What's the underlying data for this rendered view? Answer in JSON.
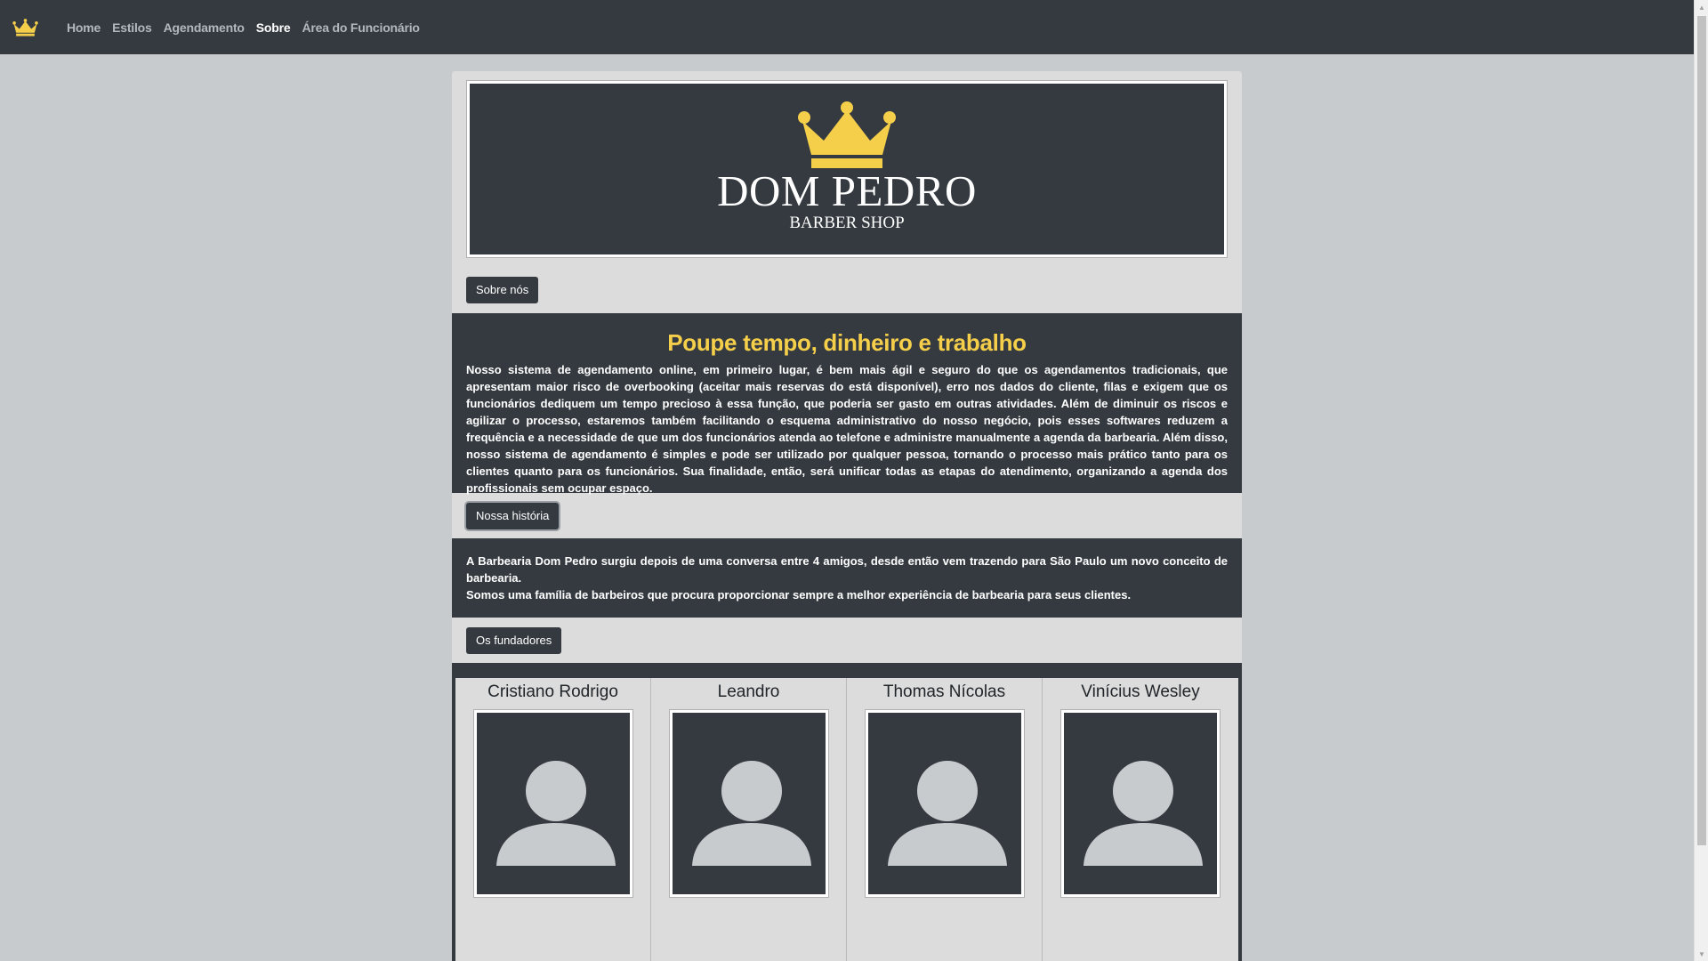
{
  "navbar": {
    "brand_icon": "crown-icon",
    "links": [
      {
        "label": "Home",
        "active": false
      },
      {
        "label": "Estilos",
        "active": false
      },
      {
        "label": "Agendamento",
        "active": false
      },
      {
        "label": "Sobre",
        "active": true
      },
      {
        "label": "Área do Funcionário",
        "active": false
      }
    ]
  },
  "hero": {
    "title": "DOM PEDRO",
    "subtitle": "BARBER SHOP",
    "crown_color": "#f6cf4a"
  },
  "sections": {
    "about_button": "Sobre nós",
    "about_heading": "Poupe tempo, dinheiro e trabalho",
    "about_text": "Nosso sistema de agendamento online, em primeiro lugar, é bem mais ágil e seguro do que os agendamentos tradicionais, que apresentam maior risco de overbooking (aceitar mais reservas do está disponível), erro nos dados do cliente, filas e exigem que os funcionários dediquem um tempo precioso à essa função, que poderia ser gasto em outras atividades. Além de diminuir os riscos e agilizar o processo, estaremos também facilitando o esquema administrativo do nosso negócio, pois esses softwares reduzem a frequência e a necessidade de que um dos funcionários atenda ao telefone e administre manualmente a agenda da barbearia. Além disso, nosso sistema de agendamento é simples e pode ser utilizado por qualquer pessoa, tornando o processo mais prático tanto para os clientes quanto para os funcionários. Sua finalidade, então, será unificar todas as etapas do atendimento, organizando a agenda dos profissionais sem ocupar espaço.",
    "history_button": "Nossa história",
    "history_p1": "A Barbearia Dom Pedro surgiu depois de uma conversa entre 4 amigos, desde então vem trazendo para São Paulo um novo conceito de barbearia.",
    "history_p2": "Somos uma família de barbeiros que procura proporcionar sempre a melhor experiência de barbearia para seus clientes.",
    "founders_button": "Os fundadores"
  },
  "founders": [
    {
      "name": "Cristiano Rodrigo"
    },
    {
      "name": "Leandro"
    },
    {
      "name": "Thomas Nícolas"
    },
    {
      "name": "Vinícius Wesley"
    }
  ],
  "colors": {
    "dark": "#343a40",
    "accent": "#f6cf4a",
    "page_bg": "#c8cbce",
    "avatar": "#c8cbce"
  }
}
